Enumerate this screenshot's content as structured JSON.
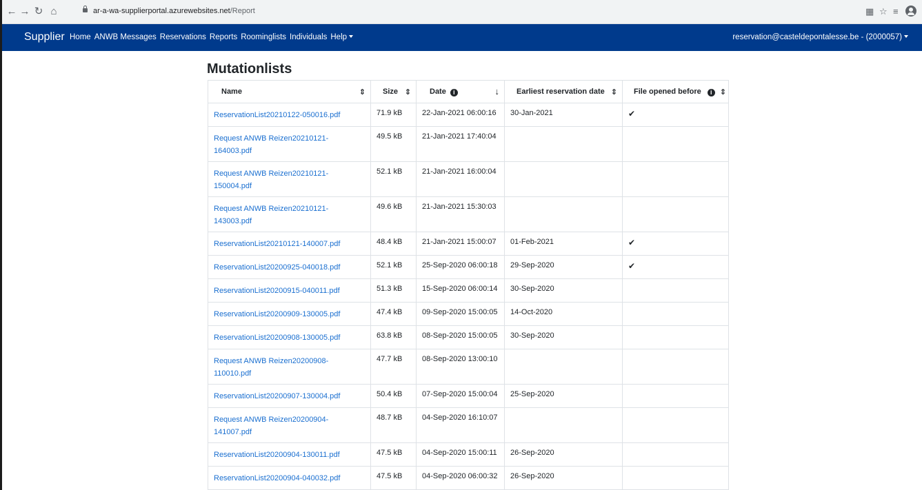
{
  "browser": {
    "url_host": "ar-a-wa-supplierportal.azurewebsites.net",
    "url_path": "/Report",
    "icons": [
      "back-arrow-icon",
      "forward-arrow-icon",
      "reload-icon",
      "home-icon",
      "lock-icon",
      "translate-icon",
      "star-icon",
      "reading-list-icon",
      "profile-icon"
    ]
  },
  "navbar": {
    "brand": "Supplier",
    "links": [
      "Home",
      "ANWB Messages",
      "Reservations",
      "Reports",
      "Roominglists",
      "Individuals",
      "Help"
    ],
    "user": "reservation@casteldepontalesse.be - (2000057)"
  },
  "page": {
    "title": "Mutationlists"
  },
  "table": {
    "headers": {
      "name": "Name",
      "size": "Size",
      "date": "Date",
      "earliest": "Earliest reservation date",
      "opened": "File opened before"
    },
    "rows": [
      {
        "name": "ReservationList20210122-050016.pdf",
        "size": "71.9 kB",
        "date": "22-Jan-2021 06:00:16",
        "earliest": "30-Jan-2021",
        "opened": true
      },
      {
        "name": "Request ANWB Reizen20210121-164003.pdf",
        "size": "49.5 kB",
        "date": "21-Jan-2021 17:40:04",
        "earliest": "",
        "opened": false
      },
      {
        "name": "Request ANWB Reizen20210121-150004.pdf",
        "size": "52.1 kB",
        "date": "21-Jan-2021 16:00:04",
        "earliest": "",
        "opened": false
      },
      {
        "name": "Request ANWB Reizen20210121-143003.pdf",
        "size": "49.6 kB",
        "date": "21-Jan-2021 15:30:03",
        "earliest": "",
        "opened": false
      },
      {
        "name": "ReservationList20210121-140007.pdf",
        "size": "48.4 kB",
        "date": "21-Jan-2021 15:00:07",
        "earliest": "01-Feb-2021",
        "opened": true
      },
      {
        "name": "ReservationList20200925-040018.pdf",
        "size": "52.1 kB",
        "date": "25-Sep-2020 06:00:18",
        "earliest": "29-Sep-2020",
        "opened": true
      },
      {
        "name": "ReservationList20200915-040011.pdf",
        "size": "51.3 kB",
        "date": "15-Sep-2020 06:00:14",
        "earliest": "30-Sep-2020",
        "opened": false
      },
      {
        "name": "ReservationList20200909-130005.pdf",
        "size": "47.4 kB",
        "date": "09-Sep-2020 15:00:05",
        "earliest": "14-Oct-2020",
        "opened": false
      },
      {
        "name": "ReservationList20200908-130005.pdf",
        "size": "63.8 kB",
        "date": "08-Sep-2020 15:00:05",
        "earliest": "30-Sep-2020",
        "opened": false
      },
      {
        "name": "Request ANWB Reizen20200908-110010.pdf",
        "size": "47.7 kB",
        "date": "08-Sep-2020 13:00:10",
        "earliest": "",
        "opened": false
      },
      {
        "name": "ReservationList20200907-130004.pdf",
        "size": "50.4 kB",
        "date": "07-Sep-2020 15:00:04",
        "earliest": "25-Sep-2020",
        "opened": false
      },
      {
        "name": "Request ANWB Reizen20200904-141007.pdf",
        "size": "48.7 kB",
        "date": "04-Sep-2020 16:10:07",
        "earliest": "",
        "opened": false
      },
      {
        "name": "ReservationList20200904-130011.pdf",
        "size": "47.5 kB",
        "date": "04-Sep-2020 15:00:11",
        "earliest": "26-Sep-2020",
        "opened": false
      },
      {
        "name": "ReservationList20200904-040032.pdf",
        "size": "47.5 kB",
        "date": "04-Sep-2020 06:00:32",
        "earliest": "26-Sep-2020",
        "opened": false
      }
    ]
  }
}
